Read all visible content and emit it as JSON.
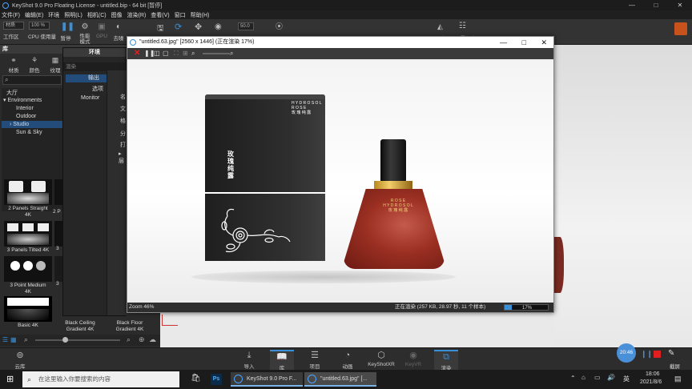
{
  "window": {
    "title": "KeyShot 9.0 Pro Floating License  - untitled.bip  - 64 bit [暂停]",
    "minimize": "—",
    "maximize": "□",
    "close": "✕"
  },
  "menu": [
    "文件(F)",
    "编辑(E)",
    "环境",
    "照明(L)",
    "相机(C)",
    "图像",
    "渲染(R)",
    "查看(V)",
    "窗口",
    "帮助(H)"
  ],
  "toolbar": {
    "material_field": "材质",
    "zoom_field": "100 %",
    "workspace_label": "工作区",
    "cpu_label": "CPU 使用量",
    "pause_label": "暂停",
    "perf_label": "性能\n模式",
    "gpu_label": "GPU",
    "denoise_label": "去噪",
    "value_field": "50.0",
    "labels_partial": [
      "渲染",
      "添加",
      "移动",
      "工具",
      "锁定",
      "添加",
      "工具",
      "几何",
      "配置程序"
    ]
  },
  "library": {
    "panel_title": "库",
    "env_title": "环境",
    "tabs": [
      "材质",
      "颜色",
      "纹理"
    ],
    "tree": [
      "大厅",
      "Environments",
      "Interior",
      "Outdoor",
      "Studio",
      "Sun & Sky"
    ],
    "selected_tree": "Studio",
    "thumbs": [
      {
        "label": "2 Panels Straight\n4K"
      },
      {
        "label": "3 Panels Tilted 4K"
      },
      {
        "label": "3 Point Medium\n4K"
      },
      {
        "label": "Basic 4K"
      },
      {
        "label": "Black Ceiling\nGradient 4K"
      },
      {
        "label": "Black Floor\nGradient 4K"
      }
    ],
    "partial_labels": [
      "2 P",
      "3",
      "3"
    ]
  },
  "render_popup": {
    "header": "渲染",
    "items": [
      "输出",
      "选项",
      "Monitor"
    ],
    "selected": "输出",
    "side_labels": [
      "名",
      "文",
      "格",
      "分",
      "打",
      "▸ 层"
    ]
  },
  "image_window": {
    "title": "\"untitled.63.jpg\" [2560 x 1446] (正在渲染 17%)",
    "zoom": "Zoom 46%",
    "status": "正在渲染 (257 KB, 28.97 秒, 11 个样本)",
    "progress_pct": 17,
    "progress_label": "17%",
    "box_text_top": "H Y D R O S O L\nR O S E\n玫 瑰 纯 露",
    "box_text_side": "玫瑰纯露",
    "bottle_text": "R O S E\nH Y D R O S O L\n玫 瑰 纯 露"
  },
  "dock": {
    "items": [
      "导入",
      "库",
      "项目",
      "动画",
      "KeyShotXR",
      "KeyVR",
      "渲染"
    ],
    "active": [
      "库",
      "渲染"
    ],
    "left": "云库",
    "right": "截屏",
    "recorder_time": "20:46"
  },
  "taskbar": {
    "search_placeholder": "在这里输入你要搜索的内容",
    "apps": [
      "KeyShot 9.0 Pro F...",
      "\"untitled.63.jpg\" [..."
    ],
    "ime": "英",
    "time": "18:06",
    "date": "2021/8/6"
  },
  "colors": {
    "accent": "#3a8fd6",
    "selected": "#244c7a",
    "red_stop": "#e02020"
  }
}
